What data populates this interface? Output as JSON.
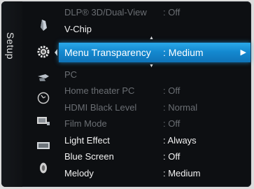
{
  "sidebar": {
    "label": "Setup"
  },
  "icons": [
    {
      "name": "picture-icon"
    },
    {
      "name": "setup-gear-icon"
    },
    {
      "name": "input-icon"
    },
    {
      "name": "clock-icon"
    },
    {
      "name": "channel-icon"
    },
    {
      "name": "application-icon"
    },
    {
      "name": "sound-icon"
    }
  ],
  "menu": {
    "items": [
      {
        "label": "DLP® 3D/Dual-View",
        "value": ": Off",
        "enabled": false
      },
      {
        "label": "V-Chip",
        "value": "",
        "enabled": true
      },
      {
        "label": "Menu Transparency",
        "value": ": Medium",
        "enabled": true,
        "selected": true
      },
      {
        "label": "PC",
        "value": "",
        "enabled": false
      },
      {
        "label": "Home theater PC",
        "value": ": Off",
        "enabled": false
      },
      {
        "label": "HDMI Black Level",
        "value": ": Normal",
        "enabled": false
      },
      {
        "label": "Film Mode",
        "value": ": Off",
        "enabled": false
      },
      {
        "label": "Light Effect",
        "value": ": Always",
        "enabled": true
      },
      {
        "label": "Blue Screen",
        "value": ": Off",
        "enabled": true
      },
      {
        "label": "Melody",
        "value": ": Medium",
        "enabled": true
      }
    ],
    "selected_arrow": "▶",
    "scroll_up": "▲",
    "scroll_down": "▼"
  }
}
